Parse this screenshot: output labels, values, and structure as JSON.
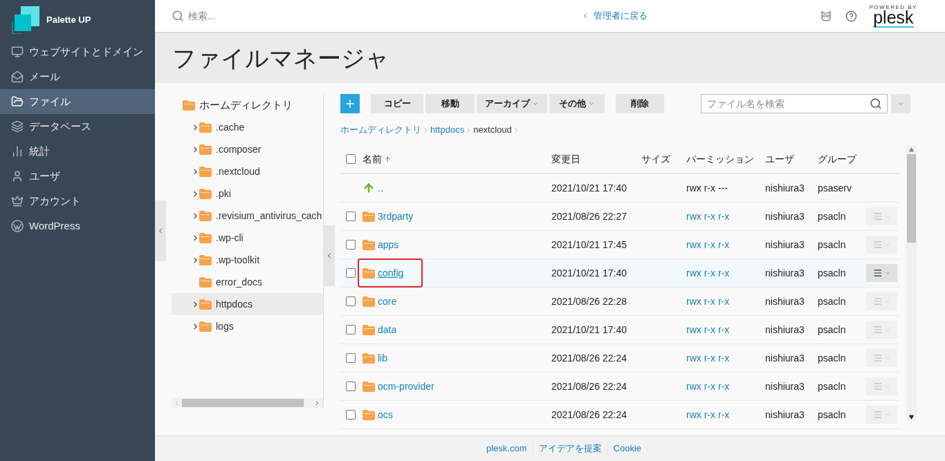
{
  "sidebar": {
    "brand": "Palette UP",
    "items": [
      {
        "label": "ウェブサイトとドメイン",
        "selected": false
      },
      {
        "label": "メール",
        "selected": false
      },
      {
        "label": "ファイル",
        "selected": true
      },
      {
        "label": "データベース",
        "selected": false
      },
      {
        "label": "統計",
        "selected": false
      },
      {
        "label": "ユーザ",
        "selected": false
      },
      {
        "label": "アカウント",
        "selected": false
      },
      {
        "label": "WordPress",
        "selected": false
      }
    ]
  },
  "topbar": {
    "search": {
      "placeholder": "検索..."
    },
    "back_link": "管理者に戻る",
    "plesk": {
      "tagline": "POWERED BY",
      "name": "plesk"
    }
  },
  "page_title": "ファイルマネージャ",
  "tree": {
    "items": [
      {
        "label": "ホームディレクトリ",
        "selected": false,
        "children": [
          {
            "label": ".cache",
            "expandable": true,
            "selected": false
          },
          {
            "label": ".composer",
            "expandable": true,
            "selected": false
          },
          {
            "label": ".nextcloud",
            "expandable": true,
            "selected": false
          },
          {
            "label": ".pki",
            "expandable": true,
            "selected": false
          },
          {
            "label": ".revisium_antivirus_cach",
            "expandable": true,
            "selected": false
          },
          {
            "label": ".wp-cli",
            "expandable": true,
            "selected": false
          },
          {
            "label": ".wp-toolkit",
            "expandable": true,
            "selected": false
          },
          {
            "label": "error_docs",
            "expandable": false,
            "selected": false
          },
          {
            "label": "httpdocs",
            "expandable": true,
            "selected": true
          },
          {
            "label": "logs",
            "expandable": true,
            "selected": false
          }
        ]
      }
    ]
  },
  "toolbar": {
    "buttons": [
      {
        "label": "コピー",
        "dropdown": false
      },
      {
        "label": "移動",
        "dropdown": false
      },
      {
        "label": "アーカイブ",
        "dropdown": true
      },
      {
        "label": "その他",
        "dropdown": true
      },
      {
        "label": "削除",
        "dropdown": false
      }
    ],
    "search": {
      "placeholder": "ファイル名を検索"
    }
  },
  "breadcrumb": [
    {
      "label": "ホームディレクトリ",
      "link": true
    },
    {
      "label": "httpdocs",
      "link": true
    },
    {
      "label": "nextcloud",
      "link": false
    }
  ],
  "table": {
    "all_checked": false,
    "columns": [
      {
        "label": "名前",
        "sorted": true
      },
      {
        "label": "変更日",
        "sorted": false
      },
      {
        "label": "サイズ",
        "sorted": false
      },
      {
        "label": "パーミッション",
        "sorted": false
      },
      {
        "label": "ユーザ",
        "sorted": false
      },
      {
        "label": "グループ",
        "sorted": false
      }
    ],
    "rows": [
      {
        "kind": "parent",
        "name": "..",
        "date": "2021/10/21 17:40",
        "permissions": "rwx r-x ---",
        "user": "nishiura3",
        "group": "psaserv",
        "selected": false,
        "outlined": false
      },
      {
        "kind": "folder",
        "name": "3rdparty",
        "date": "2021/08/26 22:27",
        "permissions": "rwx r-x r-x",
        "user": "nishiura3",
        "group": "psacln",
        "checked": false,
        "selected": false,
        "outlined": false
      },
      {
        "kind": "folder",
        "name": "apps",
        "date": "2021/10/21 17:45",
        "permissions": "rwx r-x r-x",
        "user": "nishiura3",
        "group": "psacln",
        "checked": false,
        "selected": false,
        "outlined": false
      },
      {
        "kind": "folder",
        "name": "config",
        "date": "2021/10/21 17:40",
        "permissions": "rwx r-x r-x",
        "user": "nishiura3",
        "group": "psacln",
        "checked": false,
        "selected": true,
        "outlined": true
      },
      {
        "kind": "folder",
        "name": "core",
        "date": "2021/08/26 22:28",
        "permissions": "rwx r-x r-x",
        "user": "nishiura3",
        "group": "psacln",
        "checked": false,
        "selected": false,
        "outlined": false
      },
      {
        "kind": "folder",
        "name": "data",
        "date": "2021/10/21 17:40",
        "permissions": "rwx r-x r-x",
        "user": "nishiura3",
        "group": "psacln",
        "checked": false,
        "selected": false,
        "outlined": false
      },
      {
        "kind": "folder",
        "name": "lib",
        "date": "2021/08/26 22:24",
        "permissions": "rwx r-x r-x",
        "user": "nishiura3",
        "group": "psacln",
        "checked": false,
        "selected": false,
        "outlined": false
      },
      {
        "kind": "folder",
        "name": "ocm-provider",
        "date": "2021/08/26 22:24",
        "permissions": "rwx r-x r-x",
        "user": "nishiura3",
        "group": "psacln",
        "checked": false,
        "selected": false,
        "outlined": false
      },
      {
        "kind": "folder",
        "name": "ocs",
        "date": "2021/08/26 22:24",
        "permissions": "rwx r-x r-x",
        "user": "nishiura3",
        "group": "psacln",
        "checked": false,
        "selected": false,
        "outlined": false
      }
    ]
  },
  "footer": {
    "links": [
      "plesk.com",
      "アイデアを提案",
      "Cookie"
    ]
  }
}
